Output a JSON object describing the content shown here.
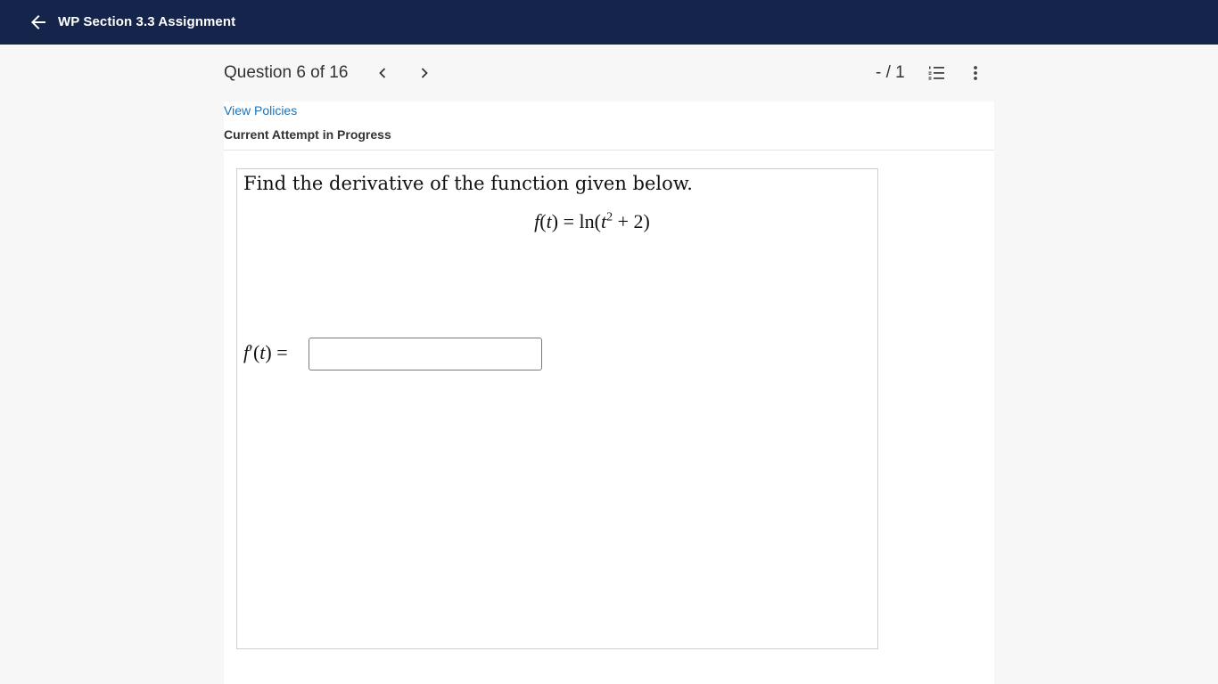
{
  "topbar": {
    "title": "WP Section 3.3 Assignment",
    "back_icon": "arrow-left-icon",
    "background": "#14244a"
  },
  "question_header": {
    "counter": "Question 6 of 16",
    "prev_icon": "chevron-left-icon",
    "next_icon": "chevron-right-icon",
    "score": "- / 1",
    "list_icon": "numbered-list-icon",
    "more_icon": "more-vertical-icon"
  },
  "panel": {
    "policies_link": "View Policies",
    "attempt_status": "Current Attempt in Progress"
  },
  "question": {
    "prompt": "Find the derivative of the function given below.",
    "equation": {
      "lhs_func": "f",
      "lhs_var": "t",
      "equals": "=",
      "ln": "ln",
      "var": "t",
      "exponent": "2",
      "plus": "+",
      "constant": "2"
    },
    "answer_label": {
      "func": "f",
      "prime": "′",
      "var": "t",
      "equals": "="
    },
    "answer_value": "",
    "answer_placeholder": ""
  },
  "colors": {
    "link": "#1a73b8",
    "page_background": "#f7f7f7"
  }
}
